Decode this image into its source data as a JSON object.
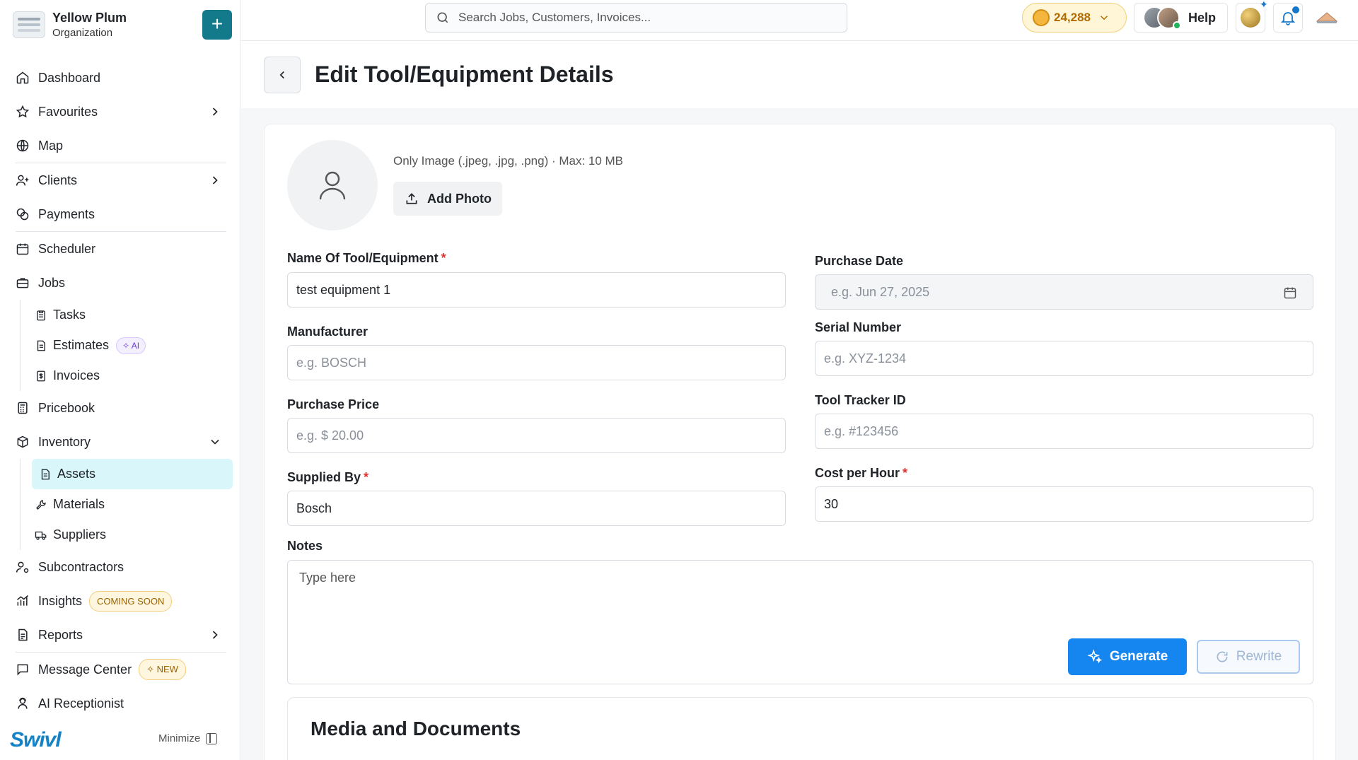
{
  "org": {
    "name": "Yellow Plum",
    "subtitle": "Organization",
    "add_label": "+"
  },
  "sidebar": {
    "dashboard": "Dashboard",
    "favourites": "Favourites",
    "map": "Map",
    "clients": "Clients",
    "payments": "Payments",
    "scheduler": "Scheduler",
    "jobs": "Jobs",
    "tasks": "Tasks",
    "estimates": "Estimates",
    "estimates_badge": "✧ AI",
    "invoices": "Invoices",
    "pricebook": "Pricebook",
    "inventory": "Inventory",
    "assets": "Assets",
    "materials": "Materials",
    "suppliers": "Suppliers",
    "subcontractors": "Subcontractors",
    "insights": "Insights",
    "insights_badge": "COMING SOON",
    "reports": "Reports",
    "message_center": "Message Center",
    "message_badge": "✧ NEW",
    "ai_receptionist": "AI Receptionist",
    "brand": "Swivl",
    "minimize": "Minimize"
  },
  "topbar": {
    "search_placeholder": "Search Jobs, Customers, Invoices...",
    "coins": "24,288",
    "help": "Help"
  },
  "page": {
    "title": "Edit Tool/Equipment Details",
    "photo_hint": "Only Image (.jpeg, .jpg, .png) · Max: 10 MB",
    "add_photo": "Add Photo"
  },
  "form": {
    "name": {
      "label": "Name Of Tool/Equipment",
      "value": "test equipment 1",
      "required": "*"
    },
    "purchase_date": {
      "label": "Purchase Date",
      "placeholder": "e.g. Jun 27, 2025"
    },
    "manufacturer": {
      "label": "Manufacturer",
      "placeholder": "e.g. BOSCH"
    },
    "serial_number": {
      "label": "Serial Number",
      "placeholder": "e.g. XYZ-1234"
    },
    "purchase_price": {
      "label": "Purchase Price",
      "placeholder": "e.g. $ 20.00"
    },
    "tool_tracker_id": {
      "label": "Tool Tracker ID",
      "placeholder": "e.g. #123456"
    },
    "supplied_by": {
      "label": "Supplied By",
      "value": "Bosch",
      "required": "*"
    },
    "cost_per_hour": {
      "label": "Cost per Hour",
      "value": "30",
      "required": "*"
    },
    "notes": {
      "label": "Notes",
      "placeholder": "Type here"
    },
    "generate": "Generate",
    "rewrite": "Rewrite"
  },
  "media": {
    "title": "Media and Documents"
  },
  "colors": {
    "accent": "#1585f0",
    "brand": "#127a8a",
    "active_bg": "#d9f7fb"
  }
}
